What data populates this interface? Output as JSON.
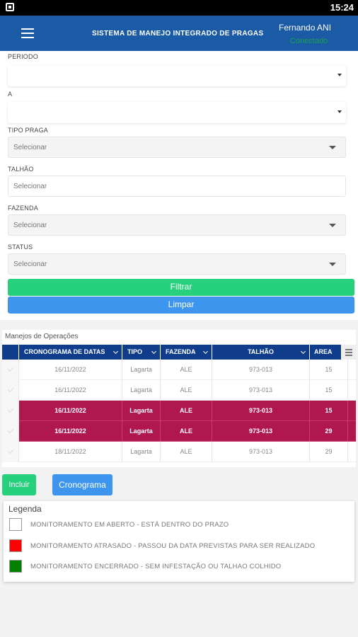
{
  "status_bar": {
    "time": "15:24"
  },
  "app_bar": {
    "title": "SISTEMA DE MANEJO INTEGRADO DE PRAGAS",
    "user_name": "Fernando ANI",
    "user_status": "Conectado"
  },
  "filters": {
    "periodo_label": "PERIODO",
    "a_label": "A",
    "tipo_praga_label": "TIPO PRAGA",
    "tipo_praga_value": "Selecionar",
    "talhao_label": "TALHÃO",
    "talhao_placeholder": "Selecionar",
    "fazenda_label": "FAZENDA",
    "fazenda_value": "Selecionar",
    "status_label": "STATUS",
    "status_value": "Selecionar",
    "filtrar_label": "Filtrar",
    "limpar_label": "Limpar"
  },
  "grid": {
    "title": "Manejos de Operações",
    "columns": [
      "CRONOGRAMA DE DATAS",
      "TIPO",
      "FAZENDA",
      "TALHÃO",
      "AREA"
    ],
    "rows": [
      {
        "data": "16/11/2022",
        "tipo": "Lagarta",
        "fazenda": "ALE",
        "talhao": "973-013",
        "area": "15",
        "status": "normal"
      },
      {
        "data": "16/11/2022",
        "tipo": "Lagarta",
        "fazenda": "ALE",
        "talhao": "973-013",
        "area": "15",
        "status": "normal"
      },
      {
        "data": "16/11/2022",
        "tipo": "Lagarta",
        "fazenda": "ALE",
        "talhao": "973-013",
        "area": "15",
        "status": "late"
      },
      {
        "data": "16/11/2022",
        "tipo": "Lagarta",
        "fazenda": "ALE",
        "talhao": "973-013",
        "area": "29",
        "status": "late"
      },
      {
        "data": "18/11/2022",
        "tipo": "Lagarta",
        "fazenda": "ALE",
        "talhao": "973-013",
        "area": "29",
        "status": "normal"
      }
    ]
  },
  "actions": {
    "incluir_label": "Incluir",
    "cronograma_label": "Cronograma"
  },
  "legend": {
    "title": "Legenda",
    "items": [
      {
        "color": "#ffffff",
        "text": "MONITORAMENTO EM ABERTO - ESTÁ DENTRO DO PRAZO"
      },
      {
        "color": "#ff0000",
        "text": "MONITORAMENTO ATRASADO - PASSOU DA DATA PREVISTAS PARA SER REALIZADO"
      },
      {
        "color": "#008000",
        "text": "MONITORAMENTO ENCERRADO - SEM INFESTAÇÃO OU TALHAO COLHIDO"
      }
    ]
  }
}
